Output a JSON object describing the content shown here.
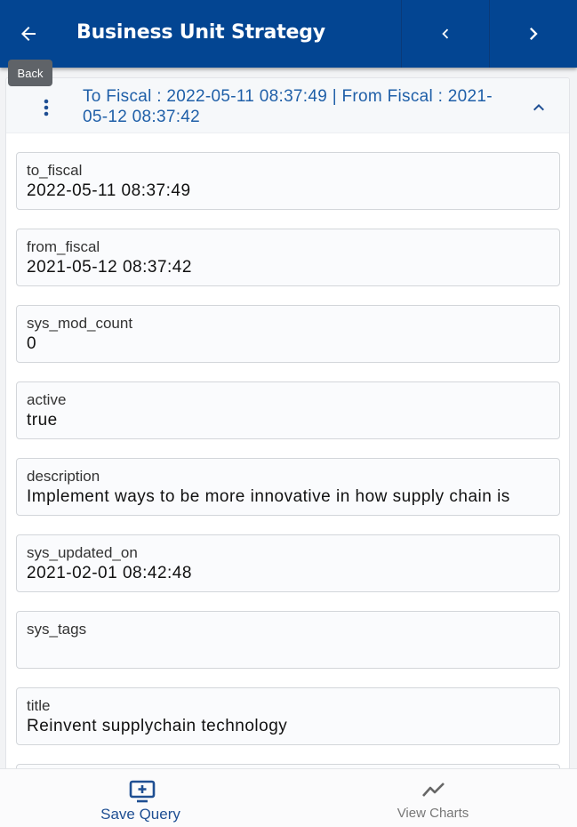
{
  "header": {
    "title": "Business Unit Strategy",
    "back_tooltip": "Back",
    "icons": {
      "back": "arrow-left-icon",
      "prev": "chevron-left-icon",
      "next": "chevron-right-icon"
    },
    "bg_color": "#034592"
  },
  "record": {
    "summary": "To Fiscal : 2022-05-11 08:37:49 | From Fiscal : 2021-05-12 08:37:42",
    "icons": {
      "menu": "more-vertical-icon",
      "collapse": "chevron-up-icon"
    },
    "fields": [
      {
        "label": "to_fiscal",
        "value": "2022-05-11 08:37:49"
      },
      {
        "label": "from_fiscal",
        "value": "2021-05-12 08:37:42"
      },
      {
        "label": "sys_mod_count",
        "value": "0"
      },
      {
        "label": "active",
        "value": "true"
      },
      {
        "label": "description",
        "value": "Implement ways to be more innovative in how supply chain is"
      },
      {
        "label": "sys_updated_on",
        "value": "2021-02-01 08:42:48"
      },
      {
        "label": "sys_tags",
        "value": ""
      },
      {
        "label": "title",
        "value": "Reinvent supplychain technology"
      }
    ]
  },
  "bottom_nav": {
    "save_query": {
      "label": "Save Query",
      "icon": "monitor-plus-icon",
      "color": "#1f4f93"
    },
    "view_charts": {
      "label": "View Charts",
      "icon": "line-chart-icon",
      "color": "#777777"
    }
  }
}
